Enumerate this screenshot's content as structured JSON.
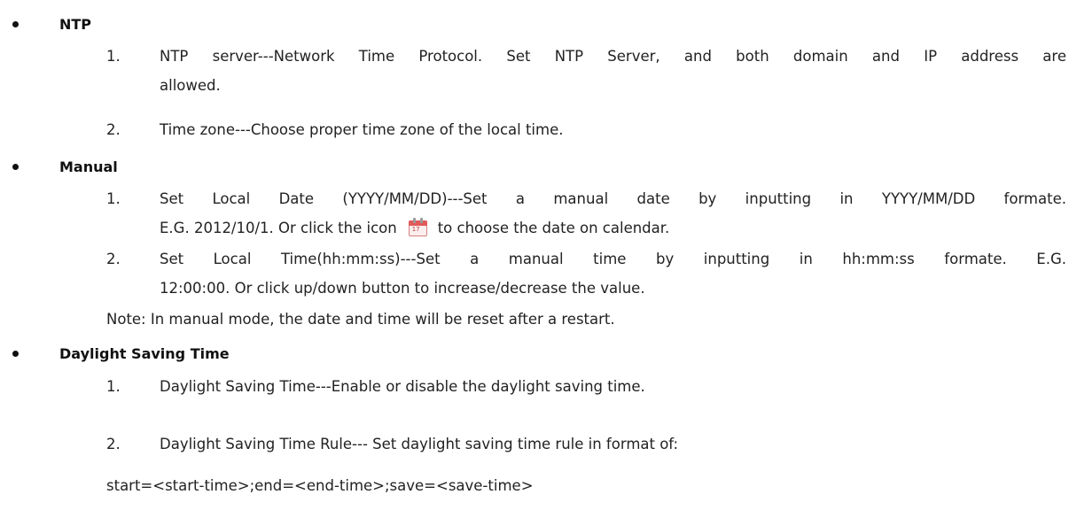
{
  "sections": [
    {
      "title": "NTP",
      "items": [
        {
          "num": "1.",
          "line1": "NTP server---Network Time Protocol. Set NTP Server, and both domain and IP address are",
          "line2": "allowed."
        },
        {
          "num": "2.",
          "line1": "Time zone---Choose proper time zone of the local time."
        }
      ]
    },
    {
      "title": "Manual",
      "items": [
        {
          "num": "1.",
          "line1": "Set Local Date (YYYY/MM/DD)---Set a manual date by inputting in YYYY/MM/DD formate.",
          "line2_before": "E.G. 2012/10/1. Or click the icon",
          "line2_after": "to choose the date on calendar."
        },
        {
          "num": "2.",
          "line1": "Set Local Time(hh:mm:ss)---Set a manual time by inputting in hh:mm:ss formate. E.G.",
          "line2": "12:00:00. Or click up/down button to increase/decrease the value."
        }
      ],
      "note": "Note: In manual mode, the date and time will be reset after a restart."
    },
    {
      "title": "Daylight Saving Time",
      "items": [
        {
          "num": "1.",
          "line1": "Daylight Saving Time---Enable or disable the daylight saving time."
        },
        {
          "num": "2.",
          "line1": "Daylight Saving Time Rule--- Set daylight saving time rule in format of:"
        }
      ],
      "rule_line": "start=<start-time>;end=<end-time>;save=<save-time>"
    }
  ],
  "icons": {
    "bullet": "bullet-dot",
    "calendar": "calendar-icon",
    "calendar_number": "17"
  },
  "colors": {
    "text": "#222222",
    "heading": "#111111",
    "calendar_accent": "#e05a5a"
  }
}
